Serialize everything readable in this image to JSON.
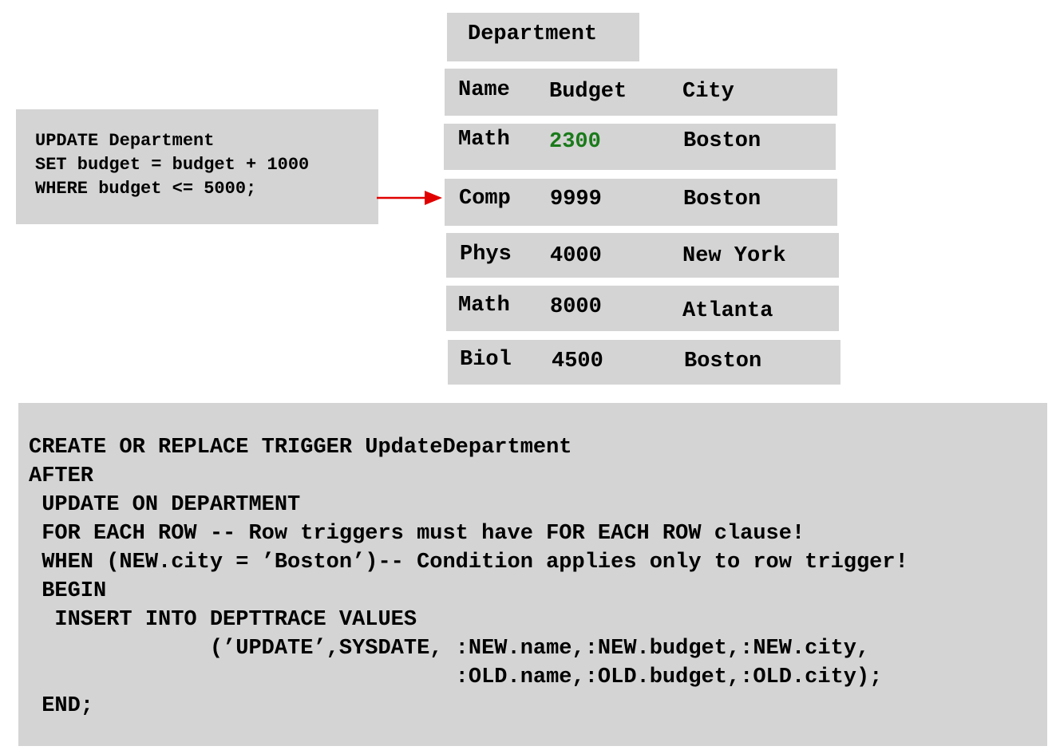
{
  "table": {
    "title": "Department",
    "headers": [
      "Name",
      "Budget",
      "City"
    ],
    "rows": [
      {
        "name": "Math",
        "budget": "2300",
        "city": "Boston",
        "budget_color": "#1a7a1a"
      },
      {
        "name": "Comp",
        "budget": "9999",
        "city": "Boston"
      },
      {
        "name": "Phys",
        "budget": "4000",
        "city": "New York"
      },
      {
        "name": "Math",
        "budget": "8000",
        "city": "Atlanta"
      },
      {
        "name": "Biol",
        "budget": "4500",
        "city": "Boston"
      }
    ]
  },
  "update_sql": {
    "lines": [
      "UPDATE Department",
      "SET budget = budget + 1000",
      "WHERE budget <= 5000;"
    ]
  },
  "arrow": {
    "color": "#e00000",
    "points_to_row": "Comp"
  },
  "trigger_code": {
    "lines": [
      "CREATE OR REPLACE TRIGGER UpdateDepartment",
      "AFTER",
      " UPDATE ON DEPARTMENT",
      " FOR EACH ROW -- Row triggers must have FOR EACH ROW clause!",
      " WHEN (NEW.city = ’Boston’)-- Condition applies only to row trigger!",
      " BEGIN",
      "  INSERT INTO DEPTTRACE VALUES",
      "              (’UPDATE’,SYSDATE, :NEW.name,:NEW.budget,:NEW.city,",
      "                                 :OLD.name,:OLD.budget,:OLD.city);",
      " END;"
    ]
  }
}
